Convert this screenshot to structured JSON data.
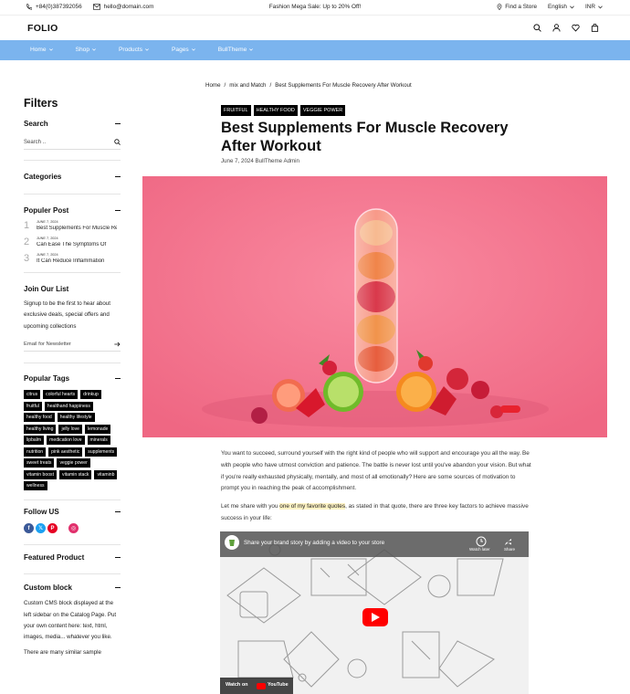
{
  "topbar": {
    "phone": "+84(0)387392056",
    "email": "hello@domain.com",
    "promo": "Fashion Mega Sale: Up to 20% Off!",
    "store_label": "Find a Store",
    "language": "English",
    "currency": "INR"
  },
  "header": {
    "logo": "FOLIO"
  },
  "nav": {
    "items": [
      "Home",
      "Shop",
      "Products",
      "Pages",
      "BullTheme"
    ]
  },
  "sidebar": {
    "title": "Filters",
    "search": {
      "heading": "Search",
      "placeholder": "Search .."
    },
    "categories": {
      "heading": "Categories"
    },
    "popular_post": {
      "heading": "Populer Post",
      "posts": [
        {
          "num": "1",
          "date": "JUNE 7, 2024",
          "title": "Best Supplements For Muscle Recovery After Workout"
        },
        {
          "num": "2",
          "date": "JUNE 7, 2024",
          "title": "Can Ease The Symptoms Of"
        },
        {
          "num": "3",
          "date": "JUNE 7, 2024",
          "title": "It Can Reduce Inflammation"
        }
      ]
    },
    "join": {
      "heading": "Join Our List",
      "text": "Signup to be the first to hear about exclusive deals, special offers and upcoming collections",
      "placeholder": "Email for Newsletter"
    },
    "tags": {
      "heading": "Popular Tags",
      "items": [
        "citrus",
        "colorful hearts",
        "drinkup",
        "fruitful",
        "healthand happiness",
        "healthy food",
        "healthy lifestyle",
        "healthy living",
        "jelly love",
        "lemonade",
        "lipbalm",
        "medication love",
        "minerals",
        "nutrition",
        "pink aesthetic",
        "supplements",
        "sweet treats",
        "veggie power",
        "vitamin boost",
        "vitamin stack",
        "vitaminb",
        "wellness"
      ]
    },
    "follow": {
      "heading": "Follow US",
      "networks": [
        "f",
        "𝕏",
        "P",
        "◎"
      ]
    },
    "featured": {
      "heading": "Featured Product"
    },
    "custom": {
      "heading": "Custom block",
      "text": "Custom CMS block displayed at the left sidebar on the Catalog Page. Put your own content here: text, html, images, media... whatever you like.",
      "text2": "There are many similar sample"
    }
  },
  "breadcrumb": {
    "home": "Home",
    "sep": "/",
    "cat": "mix and Match",
    "current": "Best Supplements For Muscle Recovery After Workout"
  },
  "post": {
    "tags": [
      "FRUITFUL",
      "HEALTHY FOOD",
      "VEGGIE POWER"
    ],
    "title": "Best Supplements For Muscle Recovery After Workout",
    "meta": "June 7, 2024 BullTheme Admin",
    "para1": "You want to succeed, surround yourself with the right kind of people who will support and encourage you all the way. Be with people who have utmost conviction and patience. The battle is never lost until you've abandon your vision. But what if you're really exhausted physically, mentally, and most of all emotionally? Here are some sources of motivation to prompt you in reaching the peak of accomplishment.",
    "para2_a": "Let me share with you ",
    "para2_hl": "one of my favorite quotes",
    "para2_b": ", as stated in that quote, there are three key factors to achieve massive success in your life:"
  },
  "video": {
    "title": "Share your brand story by adding a video to your store",
    "watch_later": "Watch later",
    "share": "Share",
    "watch_on": "Watch on",
    "platform": "YouTube"
  },
  "colors": {
    "nav": "#7bb4ee",
    "hero": "#f2708a",
    "facebook": "#3b5998",
    "twitter": "#1da1f2",
    "pinterest": "#e60023",
    "instagram": "#e1306c",
    "play": "#ff0000"
  }
}
